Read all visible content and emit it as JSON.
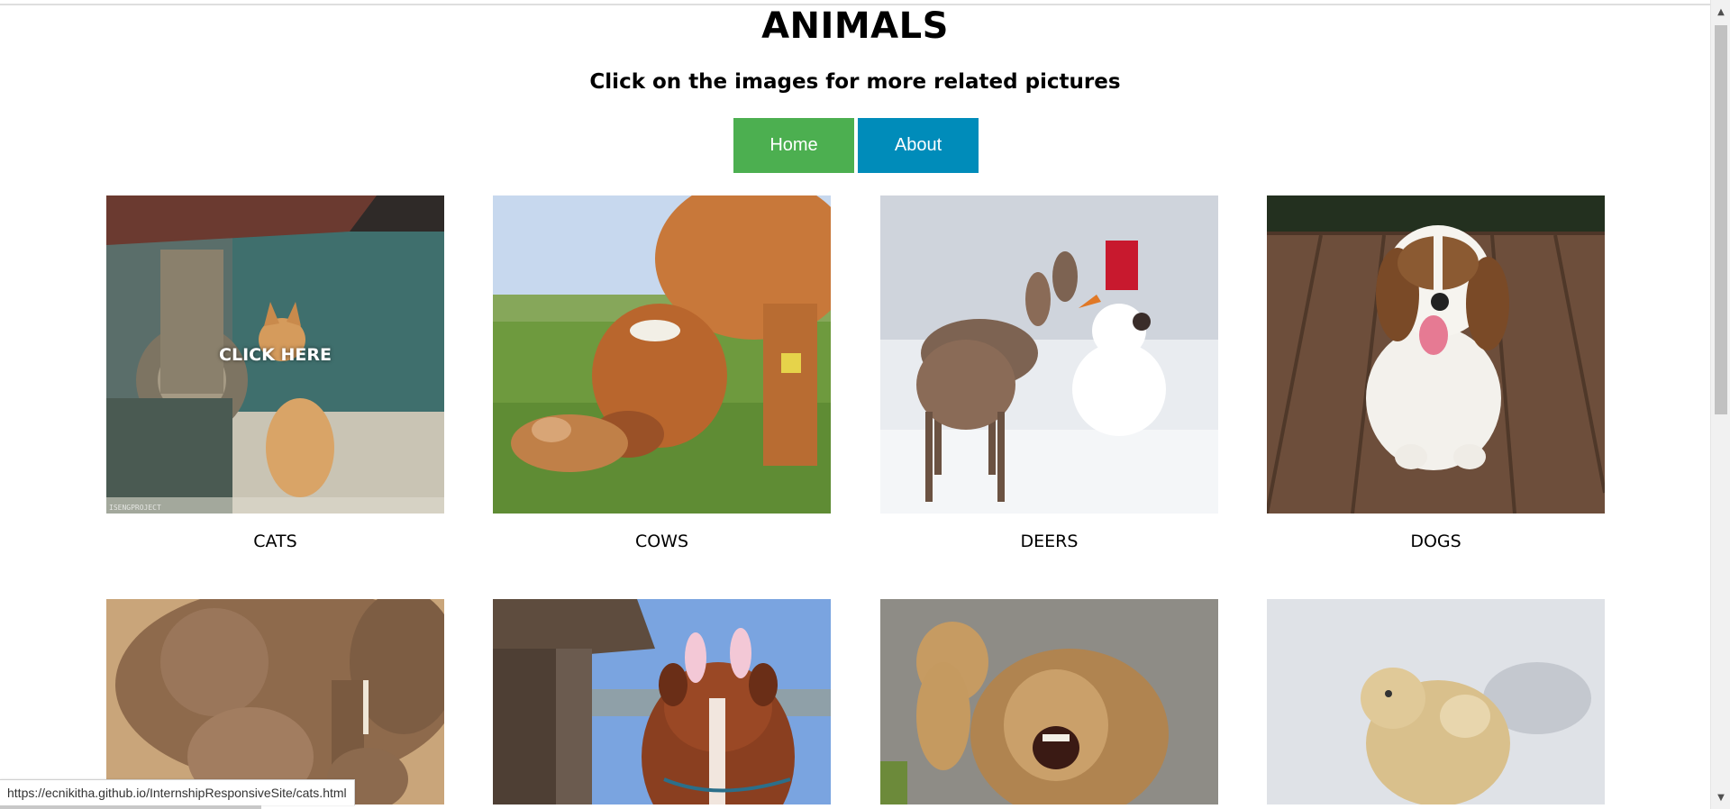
{
  "header": {
    "title": "ANIMALS",
    "subtitle": "Click on the images for more related pictures"
  },
  "nav": {
    "home_label": "Home",
    "about_label": "About",
    "home_color": "#4caf50",
    "about_color": "#008cba"
  },
  "gallery": {
    "hover_text": "CLICK HERE",
    "cats_watermark": "ISENGPROJECT",
    "items": [
      {
        "caption": "CATS",
        "image": "kitten-sitting-by-wheel"
      },
      {
        "caption": "COWS",
        "image": "cow-licking-calf-on-grass"
      },
      {
        "caption": "DEERS",
        "image": "deer-near-snowman"
      },
      {
        "caption": "DOGS",
        "image": "beagle-on-wooden-deck"
      },
      {
        "caption": "",
        "image": "elephant-family"
      },
      {
        "caption": "",
        "image": "horse-with-bunny-ears"
      },
      {
        "caption": "",
        "image": "lion-cub-and-roaring-lion"
      },
      {
        "caption": "",
        "image": "polar-bear-cub-in-snow"
      }
    ]
  },
  "status_bar": {
    "url": "https://ecnikitha.github.io/InternshipResponsiveSite/cats.html"
  }
}
